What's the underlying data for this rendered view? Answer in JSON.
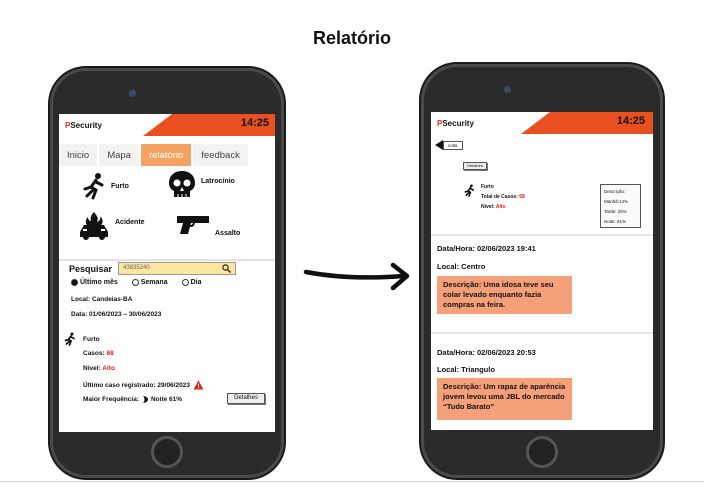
{
  "title": "Relatório",
  "left_phone": {
    "brand_p": "P",
    "brand_rest": "Security",
    "time": "14:25",
    "tabs": [
      "Inicio",
      "Mapa",
      "relatório",
      "feedback"
    ],
    "categories": [
      {
        "label": "Furto",
        "icon": "running-person-icon"
      },
      {
        "label": "Latrocínio",
        "icon": "skull-icon"
      },
      {
        "label": "Acidente",
        "icon": "car-fire-icon"
      },
      {
        "label": "Assalto",
        "icon": "gun-icon"
      }
    ],
    "search": {
      "label": "Pesquisar",
      "value": "43835240"
    },
    "period": {
      "options": [
        "Último mês",
        "Semana",
        "Dia"
      ],
      "selected": "Último mês"
    },
    "local": "Local: Candeias-BA",
    "date": "Data: 01/06/2023 – 30/06/2023",
    "summary": {
      "type": "Furto",
      "cases_label": "Casos:",
      "cases_value": "68",
      "level_label": "Nível:",
      "level_value": "Alto",
      "last_case": "Último caso registrado: 29/06/2023",
      "frequency_label": "Maior Frequência:",
      "frequency_value": "Noite 61%",
      "details_button": "Detalhes"
    }
  },
  "right_phone": {
    "brand_p": "P",
    "brand_rest": "Security",
    "time": "14:25",
    "back_label": "volta",
    "details_label": "Detalhes",
    "summary": {
      "type": "Furto",
      "total_label": "Total de Casos:",
      "total_value": "68",
      "level_label": "Nível:",
      "level_value": "Alto"
    },
    "frequency": {
      "title": "Descrição:",
      "rows": [
        "Manhã:14%",
        "Tarde: 25%",
        "Noite: 61%"
      ]
    },
    "reports": [
      {
        "datetime": "Data/Hora: 02/06/2023 19:41",
        "local": "Local: Centro",
        "description": "Descrição: Uma idosa teve seu colar levado enquanto fazia compras na feira."
      },
      {
        "datetime": "Data/Hora: 02/06/2023 20:53",
        "local": "Local: Triangulo",
        "description": "Descrição: Um rapaz de aparência jovem levou uma JBL do mercado “Tudo Barato”"
      }
    ]
  },
  "colors": {
    "accent": "#e8501f",
    "active_tab": "#f4a261",
    "search_bg": "#fbe6a0",
    "description_bg": "#f6a07a",
    "alert_red": "#d7261e"
  }
}
